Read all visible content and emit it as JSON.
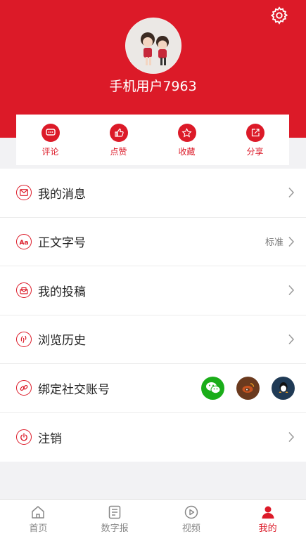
{
  "profile": {
    "username": "手机用户7963"
  },
  "actions": [
    {
      "label": "评论",
      "icon": "comment-icon"
    },
    {
      "label": "点赞",
      "icon": "thumbs-up-icon"
    },
    {
      "label": "收藏",
      "icon": "star-icon"
    },
    {
      "label": "分享",
      "icon": "share-icon"
    }
  ],
  "menu": {
    "messages": {
      "label": "我的消息",
      "icon": "envelope-icon"
    },
    "font_size": {
      "label": "正文字号",
      "value": "标准",
      "icon": "font-aa-icon"
    },
    "submissions": {
      "label": "我的投稿",
      "icon": "submission-icon"
    },
    "history": {
      "label": "浏览历史",
      "icon": "history-icon"
    },
    "social_link": {
      "label": "绑定社交账号",
      "icon": "link-icon",
      "accounts": [
        "wechat",
        "weibo",
        "qq"
      ]
    },
    "logout": {
      "label": "注销",
      "icon": "power-icon"
    }
  },
  "tabs": [
    {
      "label": "首页",
      "icon": "home-icon",
      "active": false
    },
    {
      "label": "数字报",
      "icon": "newspaper-icon",
      "active": false
    },
    {
      "label": "视频",
      "icon": "play-icon",
      "active": false
    },
    {
      "label": "我的",
      "icon": "person-icon",
      "active": true
    }
  ],
  "colors": {
    "accent": "#dc1a28",
    "wechat": "#1aad19",
    "weibo": "#6b3a1e",
    "qq": "#1f3a55"
  }
}
